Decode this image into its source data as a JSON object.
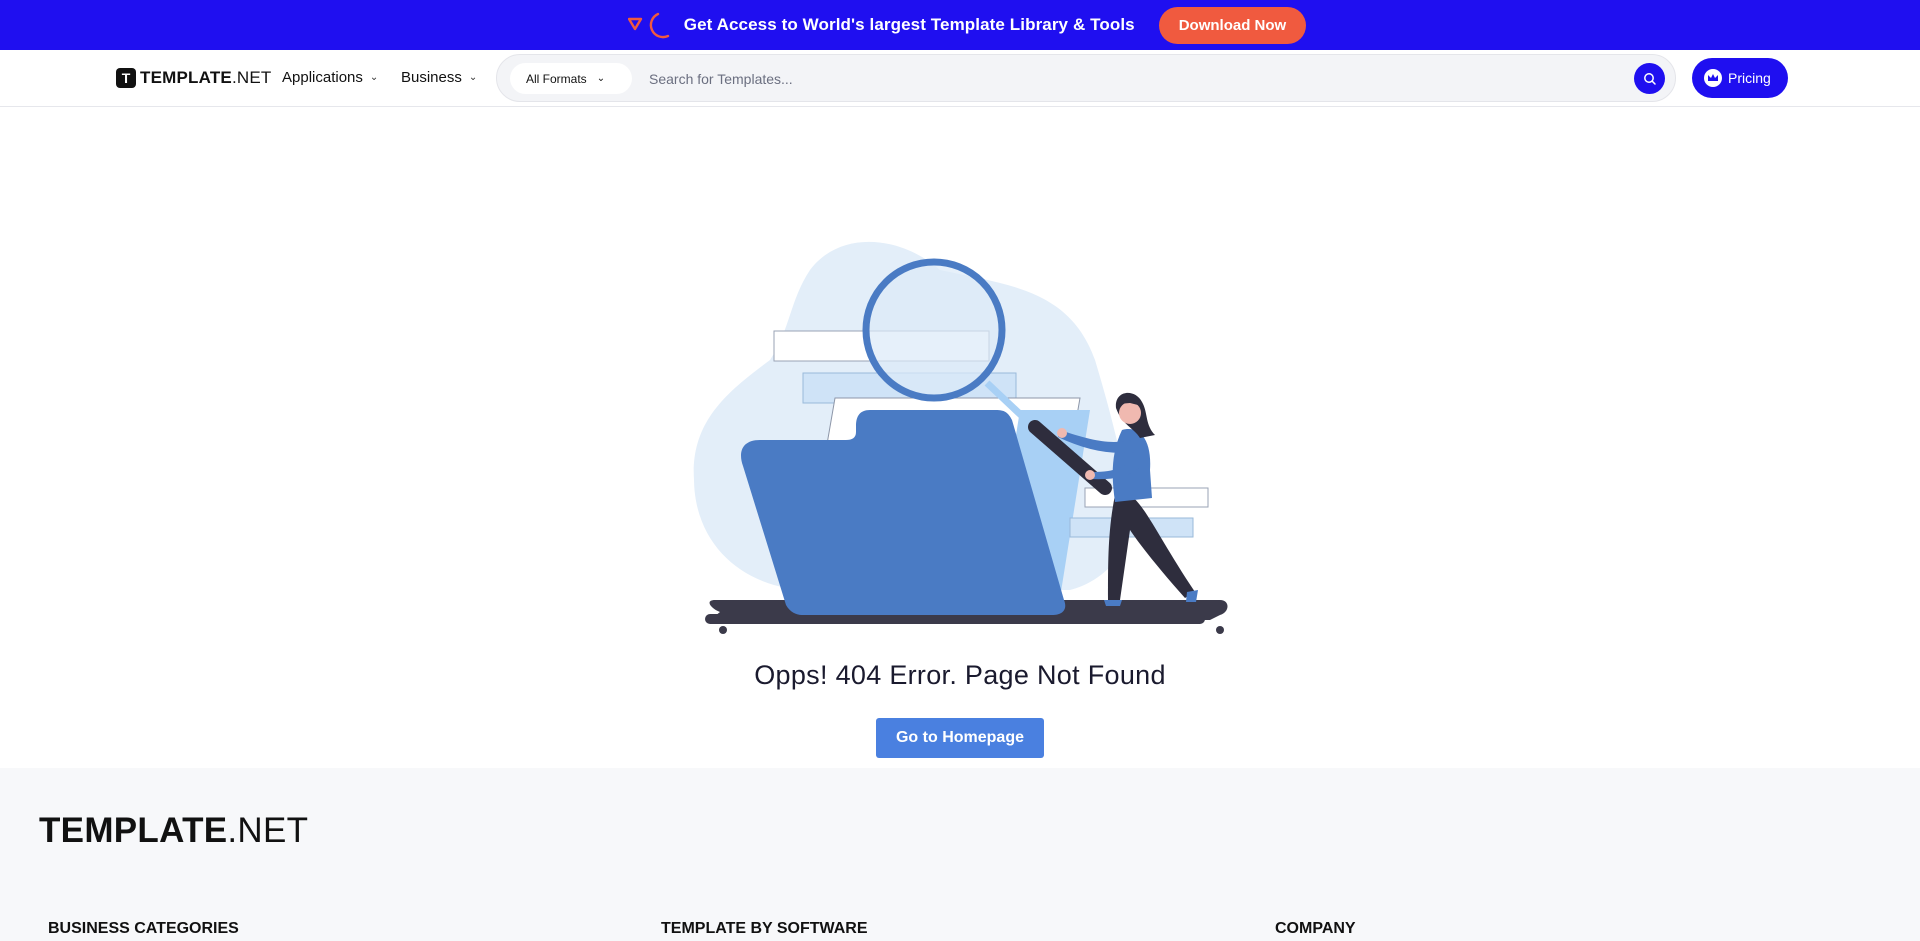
{
  "promo": {
    "text": "Get Access to World's largest Template Library & Tools",
    "button": "Download Now",
    "bg_color": "#1f0ff0",
    "button_color": "#f05a3f"
  },
  "nav": {
    "logo_bold": "TEMPLATE",
    "logo_thin": ".NET",
    "logo_mark": "T",
    "items": [
      {
        "label": "Applications"
      },
      {
        "label": "Business"
      }
    ],
    "formats": "All Formats",
    "search_placeholder": "Search for Templates...",
    "pricing": "Pricing"
  },
  "main": {
    "error_title": "Opps! 404 Error. Page Not Found",
    "home_button": "Go to Homepage",
    "accent": "#4a80e0"
  },
  "footer": {
    "logo_bold": "TEMPLATE",
    "logo_thin": ".NET",
    "columns": [
      {
        "heading": "BUSINESS CATEGORIES"
      },
      {
        "heading": "TEMPLATE BY SOFTWARE"
      },
      {
        "heading": "COMPANY"
      }
    ]
  }
}
